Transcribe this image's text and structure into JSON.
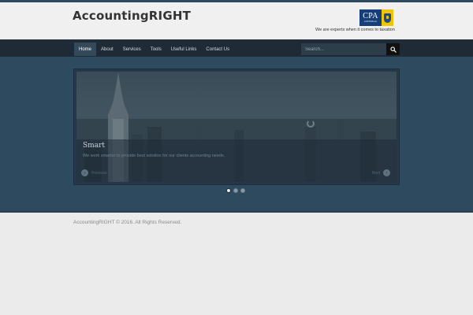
{
  "header": {
    "site_title": "AccountingRIGHT",
    "logo": {
      "text": "CPA",
      "subtext": "AUSTRALIA"
    },
    "tagline": "We are experts when it comes to taxation"
  },
  "nav": {
    "items": [
      {
        "label": "Home",
        "active": true
      },
      {
        "label": "About"
      },
      {
        "label": "Services"
      },
      {
        "label": "Tools"
      },
      {
        "label": "Useful Links"
      },
      {
        "label": "Contact Us"
      }
    ],
    "search": {
      "placeholder": "Search..."
    }
  },
  "slider": {
    "title": "Smart",
    "description": "We work smarter to provide best solution for our clients accounting needs.",
    "prev_label": "Previous",
    "next_label": "Next",
    "dots_count": 3,
    "active_dot": 0
  },
  "footer": {
    "copyright": "AccountingRIGHT © 2016. All Rights Reserved."
  },
  "colors": {
    "accent": "#2e4a5e",
    "nav_bg": "#1e2a36",
    "page_bg": "#ebebeb"
  }
}
